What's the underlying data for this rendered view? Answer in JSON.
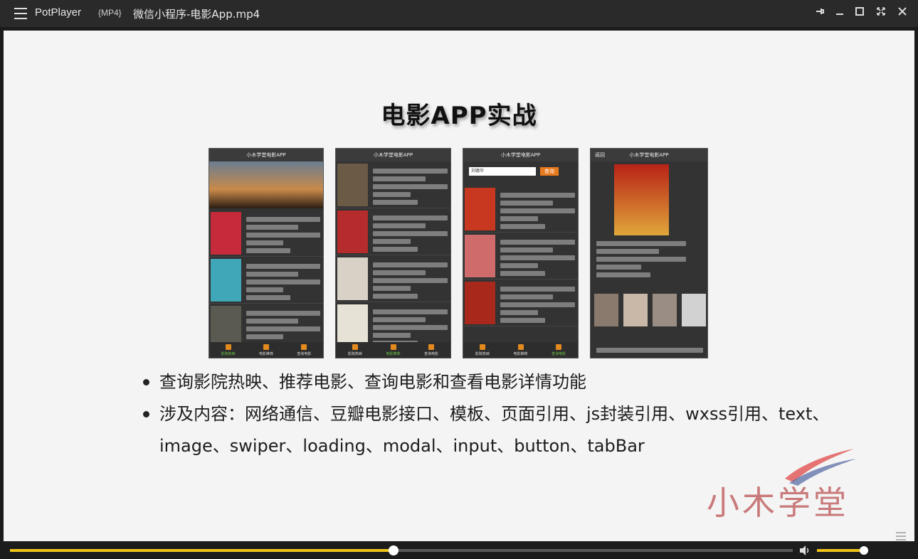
{
  "window": {
    "app_name": "PotPlayer",
    "format_tag": "{MP4}",
    "file_name": "微信小程序-电影App.mp4"
  },
  "slide": {
    "title": "电影APP实战",
    "phones": [
      {
        "header": "小木学堂电影APP",
        "tabs": [
          "影院热映",
          "电影推荐",
          "查询电影"
        ],
        "active_tab": 0
      },
      {
        "header": "小木学堂电影APP",
        "tabs": [
          "影院热映",
          "电影推荐",
          "查询电影"
        ],
        "active_tab": 1
      },
      {
        "header": "小木学堂电影APP",
        "search_value": "刘德华",
        "search_button": "查询",
        "tabs": [
          "影院热映",
          "电影推荐",
          "查询电影"
        ],
        "active_tab": 2
      },
      {
        "header": "小木学堂电影APP",
        "back_label": "返回"
      }
    ],
    "bullets": [
      "查询影院热映、推荐电影、查询电影和查看电影详情功能",
      "涉及内容：网络通信、豆瓣电影接口、模板、页面引用、js封装引用、wxss引用、text、image、swiper、loading、modal、input、button、tabBar"
    ],
    "watermark": "小木学堂"
  },
  "player": {
    "seek_progress": 0.49,
    "volume": 0.92
  },
  "colors": {
    "accent": "#f0c419",
    "titlebar": "#2a2a2a"
  }
}
